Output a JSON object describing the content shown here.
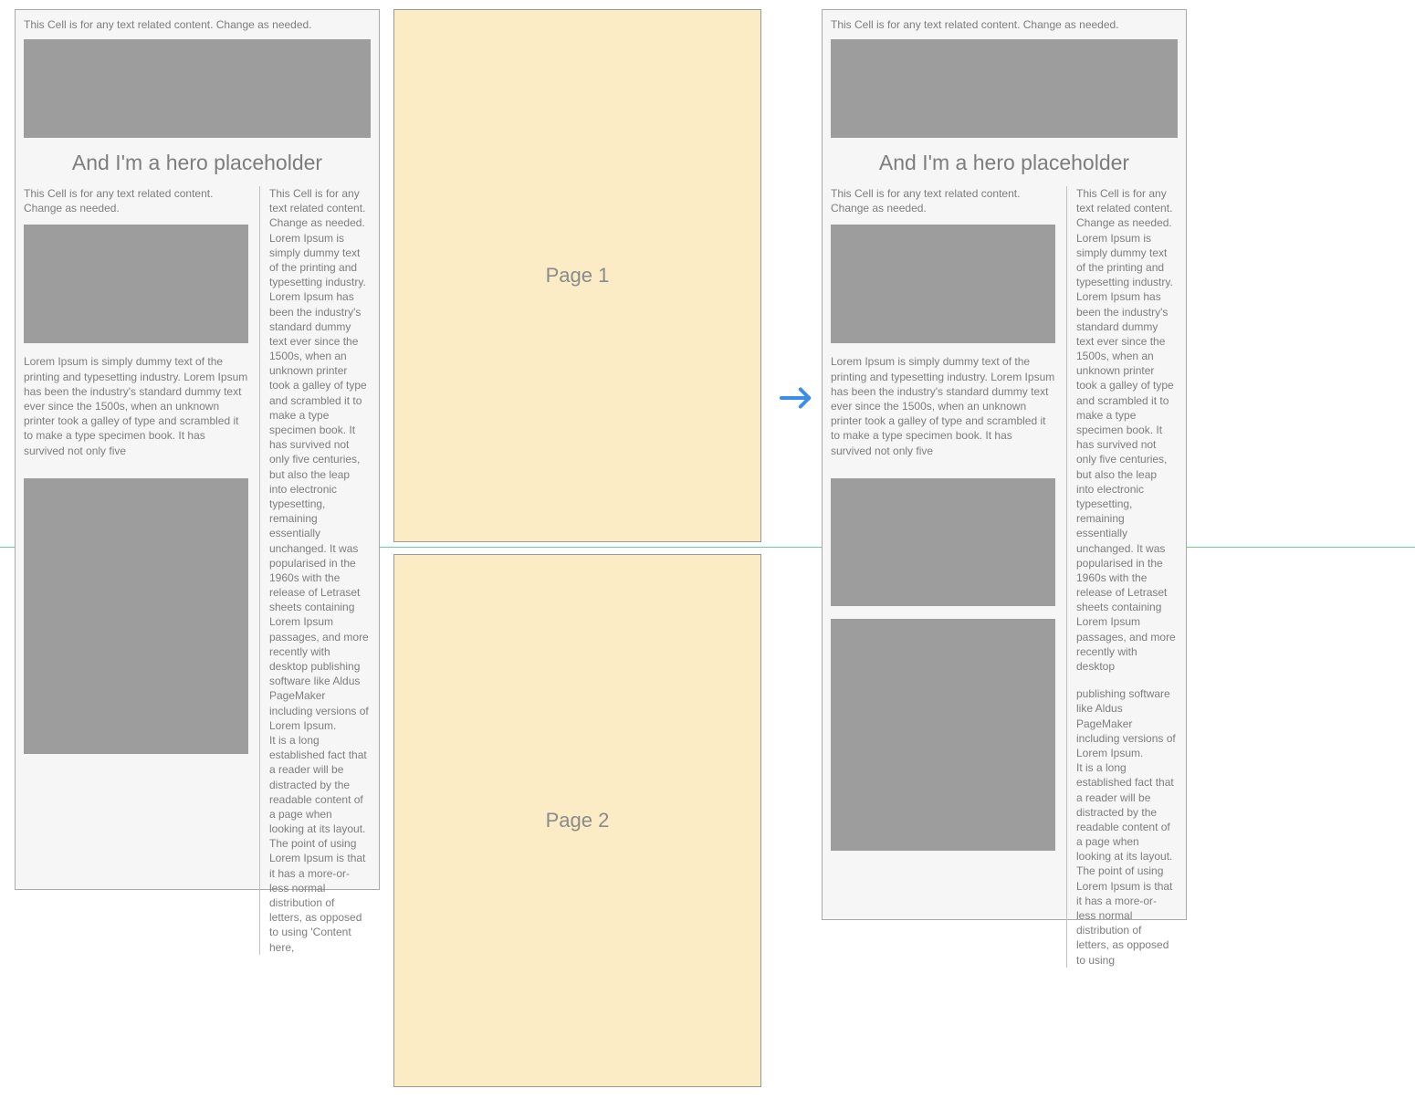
{
  "leftCard": {
    "topNote": "This Cell is for any text related content. Change as needed.",
    "heroTitle": "And I'm a hero placeholder",
    "colLeft": {
      "cellNote": "This Cell is for any text related content. Change as needed.",
      "bodyText": "Lorem Ipsum is simply dummy text of the printing and typesetting industry. Lorem Ipsum has been the industry's standard dummy text ever since the 1500s, when an unknown printer took a galley of type and scrambled it to make a type specimen book. It has survived not only five"
    },
    "colRight": {
      "bodyText": "This Cell is for any text related content. Change as needed.\nLorem Ipsum is simply dummy text of the printing and typesetting industry. Lorem Ipsum has been the industry's standard dummy text ever since the 1500s, when an unknown printer took a galley of type and scrambled it to make a type specimen book. It has survived not only five centuries, but also the leap into electronic typesetting, remaining essentially unchanged. It was popularised in the 1960s with the release of Letraset sheets containing Lorem Ipsum passages, and more recently with desktop publishing software like Aldus PageMaker including versions of Lorem Ipsum.\nIt is a long established fact that a reader will be distracted by the readable content of a page when looking at its layout. The point of using Lorem Ipsum is that it has a more-or-less normal distribution of letters, as opposed to using 'Content here,"
    }
  },
  "rightCard": {
    "topNote": "This Cell is for any text related content. Change as needed.",
    "heroTitle": "And I'm a hero placeholder",
    "colLeft": {
      "cellNote": "This Cell is for any text related content. Change as needed.",
      "bodyText": "Lorem Ipsum is simply dummy text of the printing and typesetting industry. Lorem Ipsum has been the industry's standard dummy text ever since the 1500s, when an unknown printer took a galley of type and scrambled it to make a type specimen book. It has survived not only five"
    },
    "colRight": {
      "topText": "This Cell is for any text related content. Change as needed.\nLorem Ipsum is simply dummy text of the printing and typesetting industry. Lorem Ipsum has been the industry's standard dummy text ever since the 1500s, when an unknown printer took a galley of type and scrambled it to make a type specimen book. It has survived not only five centuries, but also the leap into electronic typesetting, remaining essentially unchanged. It was popularised in the 1960s with the release of Letraset sheets containing Lorem Ipsum passages, and more recently with desktop",
      "bottomText": "publishing software like Aldus PageMaker including versions of Lorem Ipsum.\nIt is a long established fact that a reader will be distracted by the readable content of a page when looking at its layout. The point of using Lorem Ipsum is that it has a more-or-less normal distribution of letters, as opposed to using"
    }
  },
  "pages": {
    "page1": "Page 1",
    "page2": "Page 2"
  }
}
